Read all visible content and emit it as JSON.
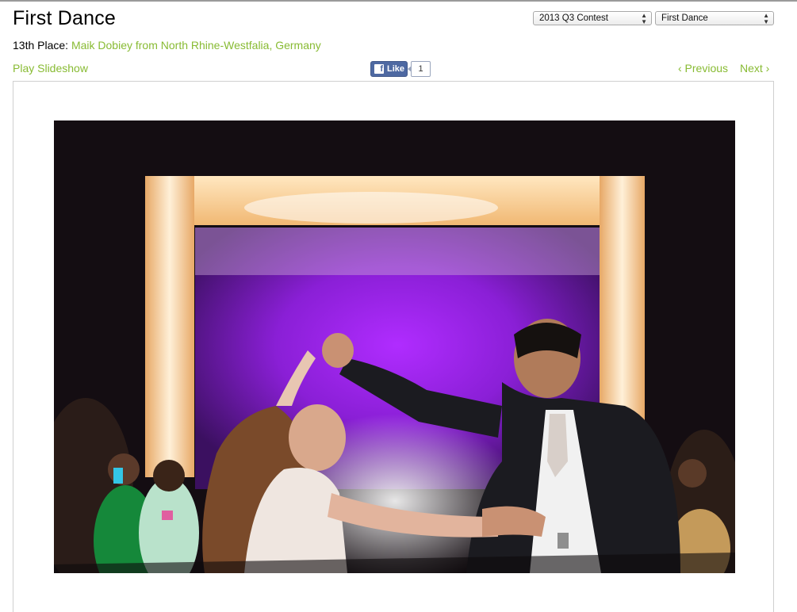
{
  "page": {
    "title": "First Dance"
  },
  "selectors": {
    "contest": "2013 Q3 Contest",
    "category": "First Dance"
  },
  "placement": {
    "rank_label": "13th Place:",
    "photographer": "Maik Dobiey from North Rhine-Westfalia, Germany"
  },
  "toolbar": {
    "play_slideshow": "Play Slideshow",
    "like_label": "Like",
    "like_count": "1",
    "previous": "‹ Previous",
    "next": "Next ›"
  },
  "icons": {
    "facebook": "facebook-icon",
    "select_arrows": "select-arrows-icon"
  },
  "colors": {
    "link": "#88bb33",
    "facebook": "#4e69a2"
  }
}
